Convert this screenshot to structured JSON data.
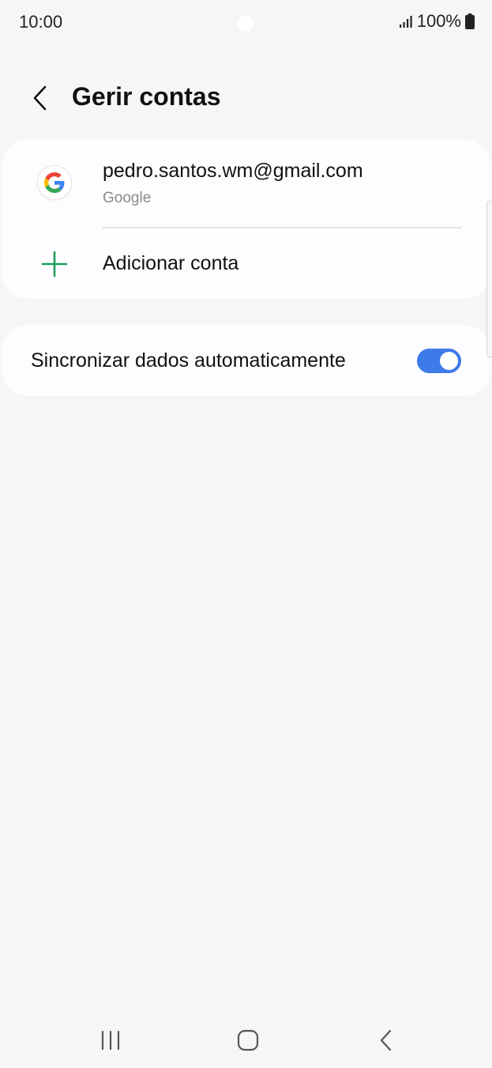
{
  "status_bar": {
    "time": "10:00",
    "battery": "100%",
    "icons": [
      "signal-icon",
      "battery-icon"
    ]
  },
  "header": {
    "title": "Gerir contas",
    "back_icon": "chevron-left-icon"
  },
  "accounts": {
    "items": [
      {
        "email": "pedro.santos.wm@gmail.com",
        "type": "Google",
        "icon": "google-g-icon"
      }
    ],
    "add_account_label": "Adicionar conta",
    "add_icon": "plus-icon",
    "accent_color": "#1e9e5a"
  },
  "sync": {
    "label": "Sincronizar dados automaticamente",
    "enabled": true,
    "toggle_color": "#3e7be8"
  },
  "nav_bar": {
    "buttons": [
      "recent-apps-icon",
      "home-icon",
      "back-icon"
    ]
  }
}
